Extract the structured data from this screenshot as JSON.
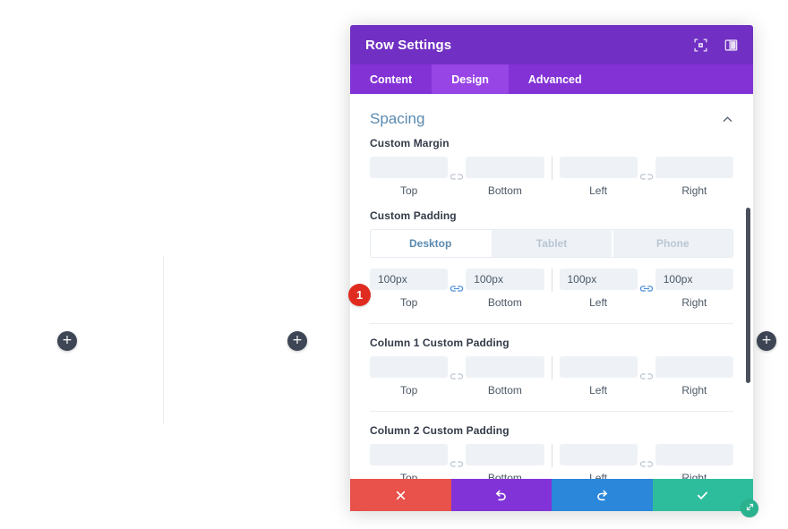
{
  "canvas": {
    "add_column_1_label": "+",
    "add_column_2_label": "+",
    "add_row_label": "+"
  },
  "modal": {
    "title": "Row Settings",
    "header_icons": [
      {
        "name": "fullscreen-icon"
      },
      {
        "name": "layout-columns-icon"
      }
    ],
    "tabs": [
      {
        "label": "Content",
        "active": false
      },
      {
        "label": "Design",
        "active": true
      },
      {
        "label": "Advanced",
        "active": false
      }
    ],
    "section": {
      "title": "Spacing",
      "collapse_icon": "chevron-up-icon"
    },
    "step_badge": "1",
    "groups": [
      {
        "id": "custom-margin",
        "label": "Custom Margin",
        "has_device_tabs": false,
        "link_left_active": false,
        "link_right_active": false,
        "fields": [
          {
            "value": "",
            "placeholder": "",
            "caption": "Top"
          },
          {
            "value": "",
            "placeholder": "",
            "caption": "Bottom"
          },
          {
            "value": "",
            "placeholder": "",
            "caption": "Left"
          },
          {
            "value": "",
            "placeholder": "",
            "caption": "Right"
          }
        ]
      },
      {
        "id": "custom-padding",
        "label": "Custom Padding",
        "has_device_tabs": true,
        "link_left_active": true,
        "link_right_active": true,
        "device_tabs": [
          {
            "label": "Desktop",
            "active": true
          },
          {
            "label": "Tablet",
            "active": false
          },
          {
            "label": "Phone",
            "active": false
          }
        ],
        "fields": [
          {
            "value": "100px",
            "placeholder": "",
            "caption": "Top"
          },
          {
            "value": "100px",
            "placeholder": "",
            "caption": "Bottom"
          },
          {
            "value": "100px",
            "placeholder": "",
            "caption": "Left"
          },
          {
            "value": "100px",
            "placeholder": "",
            "caption": "Right"
          }
        ]
      },
      {
        "id": "column-1-custom-padding",
        "label": "Column 1 Custom Padding",
        "has_device_tabs": false,
        "link_left_active": false,
        "link_right_active": false,
        "fields": [
          {
            "value": "",
            "placeholder": "",
            "caption": "Top"
          },
          {
            "value": "",
            "placeholder": "",
            "caption": "Bottom"
          },
          {
            "value": "",
            "placeholder": "",
            "caption": "Left"
          },
          {
            "value": "",
            "placeholder": "",
            "caption": "Right"
          }
        ]
      },
      {
        "id": "column-2-custom-padding",
        "label": "Column 2 Custom Padding",
        "has_device_tabs": false,
        "link_left_active": false,
        "link_right_active": false,
        "fields": [
          {
            "value": "",
            "placeholder": "",
            "caption": "Top"
          },
          {
            "value": "",
            "placeholder": "",
            "caption": "Bottom"
          },
          {
            "value": "",
            "placeholder": "",
            "caption": "Left"
          },
          {
            "value": "",
            "placeholder": "",
            "caption": "Right"
          }
        ]
      }
    ],
    "footer": [
      {
        "name": "cancel-button",
        "icon": "close-icon"
      },
      {
        "name": "undo-button",
        "icon": "undo-icon"
      },
      {
        "name": "redo-button",
        "icon": "redo-icon"
      },
      {
        "name": "save-button",
        "icon": "check-icon"
      }
    ],
    "resize_handle": "resize-diagonal-icon"
  },
  "colors": {
    "header_purple": "#7130c3",
    "tabbar_purple": "#8332d6",
    "active_tab_purple": "#9845e6",
    "section_title_blue": "#5a8ab0",
    "badge_red": "#e02b20",
    "cancel_red": "#e9514b",
    "undo_purple": "#8233d8",
    "redo_blue": "#2b87da",
    "save_green": "#2ebd9c",
    "input_bg": "#eef2f6",
    "add_button_dark": "#3e4555"
  }
}
